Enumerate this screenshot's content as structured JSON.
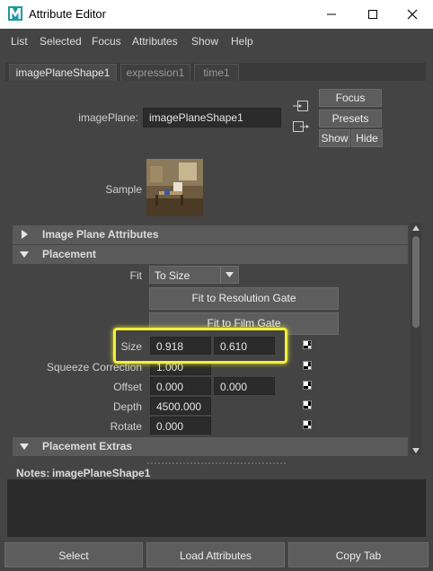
{
  "window": {
    "title": "Attribute Editor",
    "app_icon": "maya-m-icon"
  },
  "menu": [
    "List",
    "Selected",
    "Focus",
    "Attributes",
    "Show",
    "Help"
  ],
  "tabs": [
    {
      "label": "imagePlaneShape1",
      "active": true
    },
    {
      "label": "expression1",
      "active": false
    },
    {
      "label": "time1",
      "active": false
    }
  ],
  "node": {
    "label": "imagePlane:",
    "value": "imagePlaneShape1",
    "focus": "Focus",
    "presets": "Presets",
    "show": "Show",
    "hide": "Hide",
    "sample_label": "Sample"
  },
  "sections": {
    "image_plane_attributes": "Image Plane Attributes",
    "placement": "Placement",
    "placement_extras": "Placement Extras"
  },
  "placement": {
    "fit_label": "Fit",
    "fit_value": "To Size",
    "fit_resolution_gate": "Fit to Resolution Gate",
    "fit_film_gate": "Fit to Film Gate",
    "size_label": "Size",
    "size_x": "0.918",
    "size_y": "0.610",
    "squeeze_label": "Squeeze Correction",
    "squeeze_value": "1.000",
    "offset_label": "Offset",
    "offset_x": "0.000",
    "offset_y": "0.000",
    "depth_label": "Depth",
    "depth_value": "4500.000",
    "rotate_label": "Rotate",
    "rotate_value": "0.000"
  },
  "notes": {
    "label": "Notes:",
    "node": "imagePlaneShape1"
  },
  "bottom_buttons": [
    "Select",
    "Load Attributes",
    "Copy Tab"
  ],
  "colors": {
    "highlight": "#f2f03a",
    "panel": "#444444",
    "field": "#2b2b2b"
  }
}
